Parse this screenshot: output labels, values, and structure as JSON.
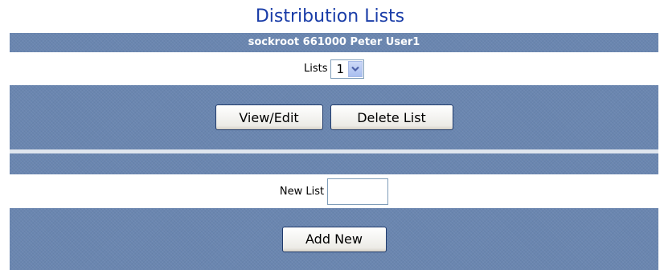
{
  "page": {
    "title": "Distribution Lists"
  },
  "user_header": "sockroot 661000  Peter User1",
  "lists": {
    "label": "Lists",
    "selected": "1"
  },
  "buttons": {
    "view_edit": "View/Edit",
    "delete_list": "Delete List",
    "add_new": "Add New"
  },
  "new_list": {
    "label": "New List",
    "value": ""
  },
  "colors": {
    "panel_blue": "#6a86b0",
    "title_blue": "#1a3da8"
  },
  "icons": {
    "select_arrow": "chevron-down-icon"
  }
}
